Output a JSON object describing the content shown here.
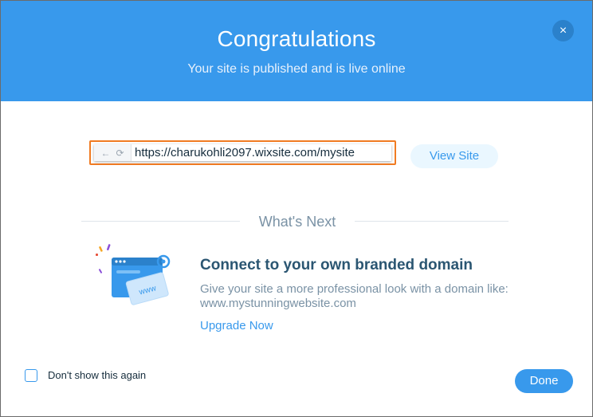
{
  "header": {
    "title": "Congratulations",
    "subtitle": "Your site is published and is live online",
    "close_icon": "×"
  },
  "url_bar": {
    "back_icon": "←",
    "reload_icon": "⟳",
    "url": "https://charukohli2097.wixsite.com/mysite"
  },
  "view_site_label": "View Site",
  "whats_next": "What's Next",
  "promo": {
    "title": "Connect to your own branded domain",
    "description": "Give your site a more professional look with a domain like: www.mystunningwebsite.com",
    "link": "Upgrade Now",
    "illustration_text": "www"
  },
  "footer": {
    "checkbox_label": "Don't show this again",
    "done_label": "Done"
  },
  "colors": {
    "accent": "#3899ec",
    "highlight": "#f07b22",
    "title_text": "#2b5672",
    "muted_text": "#7a92a5"
  }
}
